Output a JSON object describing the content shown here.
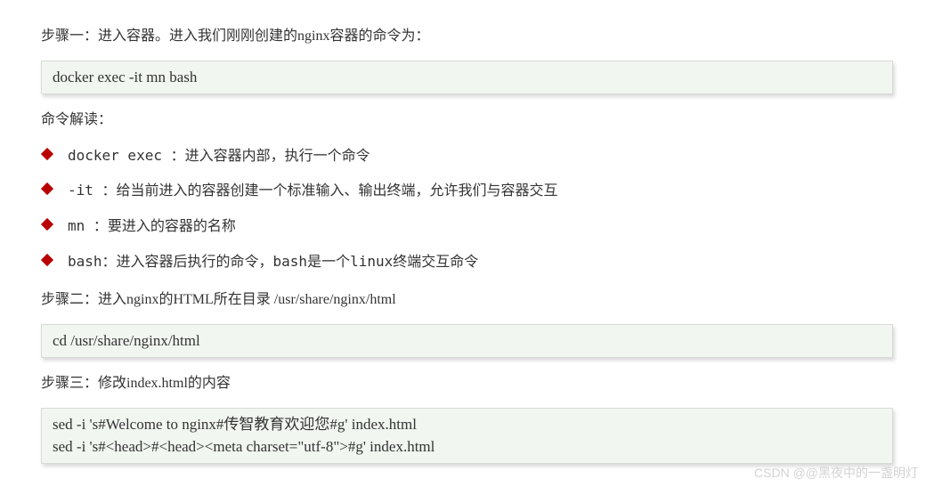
{
  "step1": {
    "text": "步骤一：进入容器。进入我们刚刚创建的nginx容器的命令为：",
    "code": "docker exec -it mn bash"
  },
  "interpret_label": "命令解读：",
  "bullets": [
    "docker exec ：进入容器内部，执行一个命令",
    "-it ：给当前进入的容器创建一个标准输入、输出终端，允许我们与容器交互",
    "mn ：要进入的容器的名称",
    "bash：进入容器后执行的命令，bash是一个linux终端交互命令"
  ],
  "step2": {
    "text": "步骤二：进入nginx的HTML所在目录 /usr/share/nginx/html",
    "code": "cd /usr/share/nginx/html"
  },
  "step3": {
    "text": "步骤三：修改index.html的内容",
    "code_line1": "sed -i 's#Welcome to nginx#传智教育欢迎您#g' index.html",
    "code_line2": "sed -i 's#<head>#<head><meta charset=\"utf-8\">#g' index.html"
  },
  "watermark": "CSDN @@黑夜中的一盏明灯"
}
